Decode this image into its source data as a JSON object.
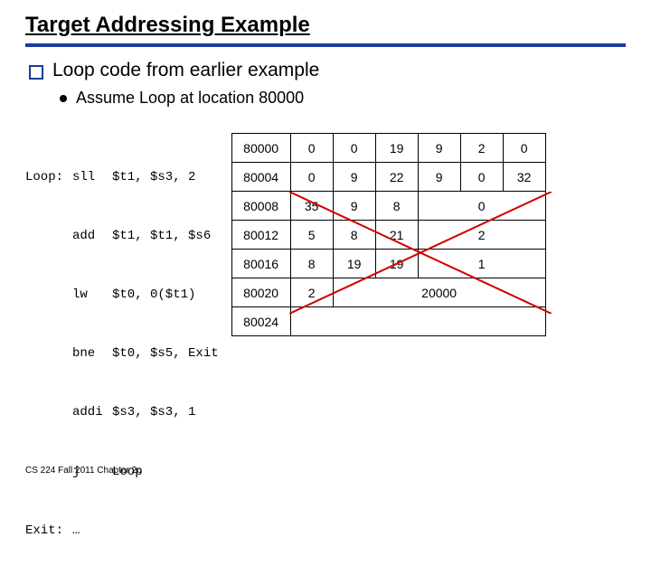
{
  "title": "Target Addressing Example",
  "bullet1": "Loop code from earlier example",
  "bullet2": "Assume Loop at location 80000",
  "code": {
    "r0": {
      "label": "Loop:",
      "op": "sll",
      "args": "$t1, $s3, 2"
    },
    "r1": {
      "label": "",
      "op": "add",
      "args": "$t1, $t1, $s6"
    },
    "r2": {
      "label": "",
      "op": "lw",
      "args": "$t0, 0($t1)"
    },
    "r3": {
      "label": "",
      "op": "bne",
      "args": "$t0, $s5, Exit"
    },
    "r4": {
      "label": "",
      "op": "addi",
      "args": "$s3, $s3, 1"
    },
    "r5": {
      "label": "",
      "op": "j",
      "args": "Loop"
    },
    "r6": {
      "label": "Exit:",
      "op": "…",
      "args": ""
    }
  },
  "table": {
    "r0": {
      "addr": "80000",
      "c": [
        "0",
        "0",
        "19",
        "9",
        "2",
        "0"
      ]
    },
    "r1": {
      "addr": "80004",
      "c": [
        "0",
        "9",
        "22",
        "9",
        "0",
        "32"
      ]
    },
    "r2": {
      "addr": "80008",
      "c": [
        "35",
        "9",
        "8",
        "0"
      ]
    },
    "r3": {
      "addr": "80012",
      "c": [
        "5",
        "8",
        "21",
        "2"
      ]
    },
    "r4": {
      "addr": "80016",
      "c": [
        "8",
        "19",
        "19",
        "1"
      ]
    },
    "r5": {
      "addr": "80020",
      "c": [
        "2",
        "20000"
      ]
    },
    "r6": {
      "addr": "80024"
    }
  },
  "footer": "CS 224 Fall 2011 Chapter 2c"
}
